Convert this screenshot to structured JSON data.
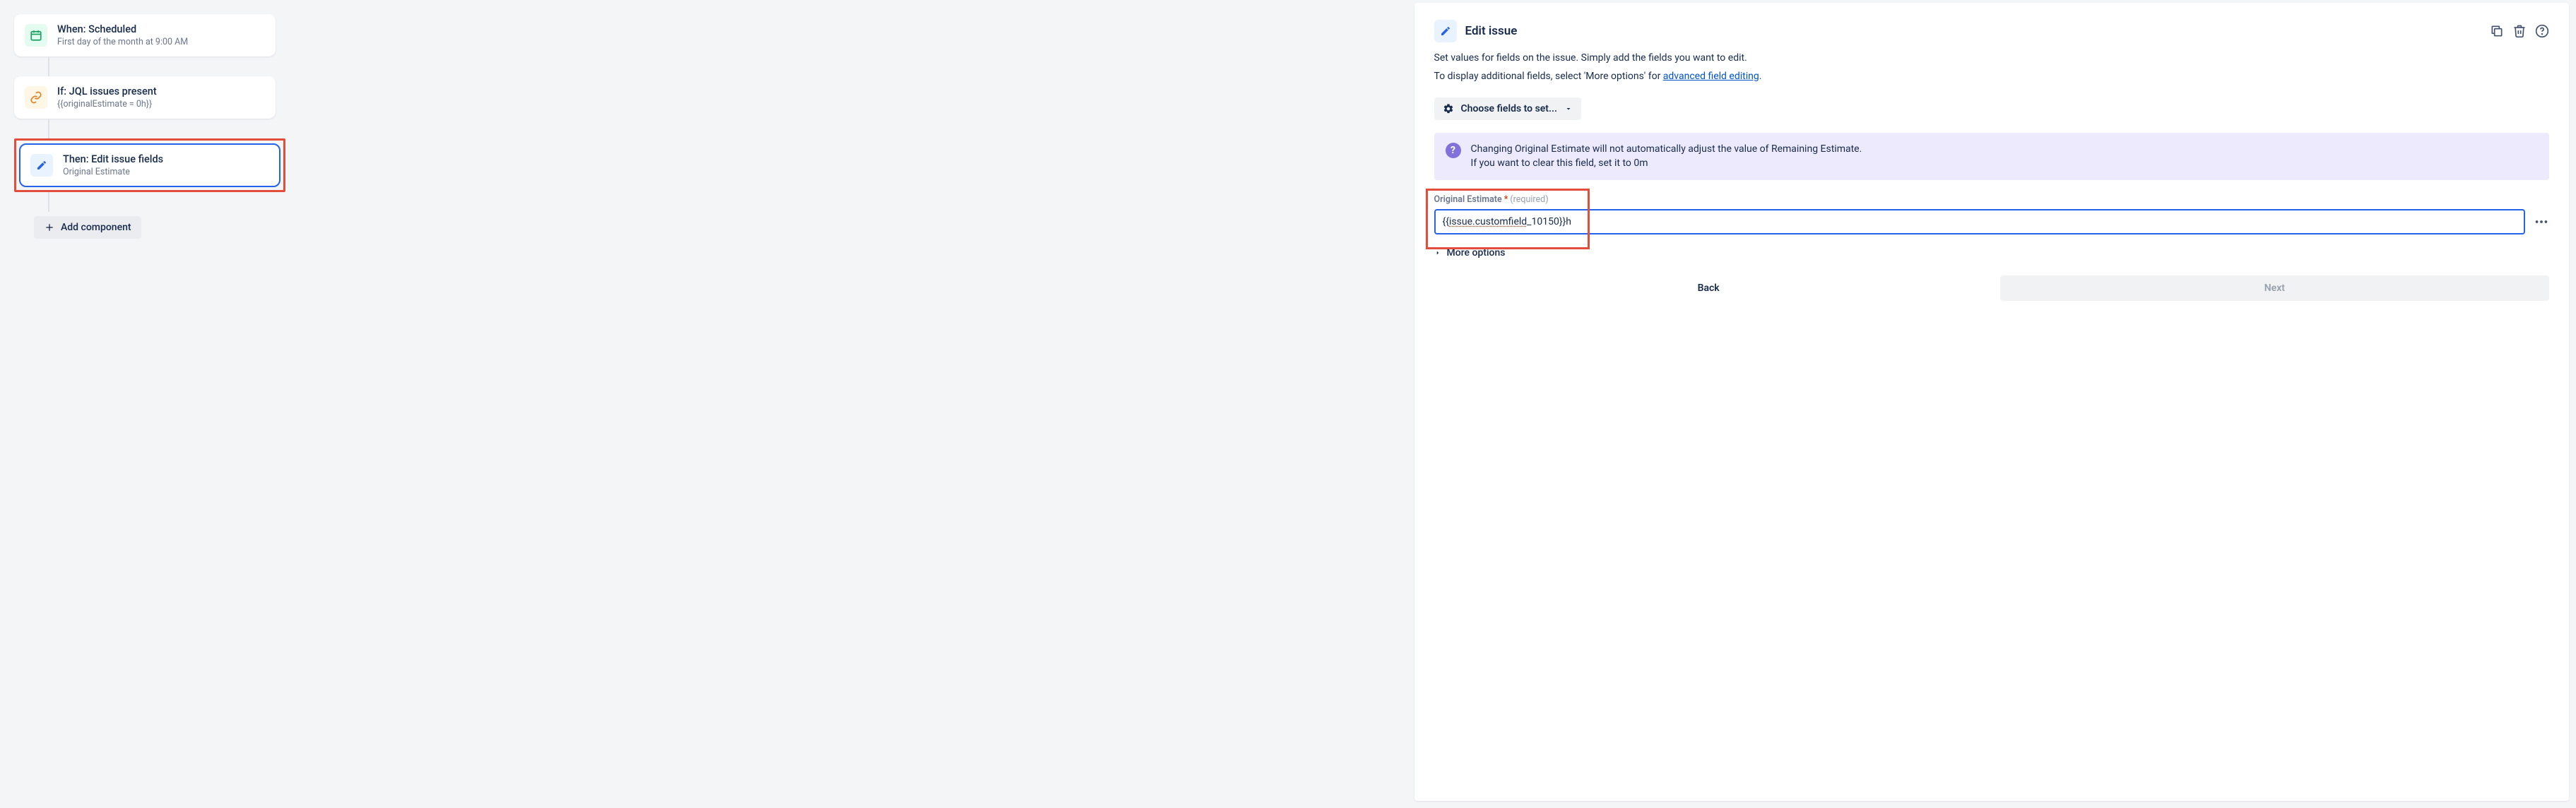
{
  "rules": {
    "trigger": {
      "title": "When: Scheduled",
      "sub": "First day of the month at 9:00 AM"
    },
    "condition": {
      "title": "If: JQL issues present",
      "sub": "{{originalEstimate = 0h}}"
    },
    "action": {
      "title": "Then: Edit issue fields",
      "sub": "Original Estimate"
    },
    "add_label": "Add component"
  },
  "panel": {
    "title": "Edit issue",
    "desc1": "Set values for fields on the issue. Simply add the fields you want to edit.",
    "desc2_prefix": "To display additional fields, select 'More options' for ",
    "desc2_link": "advanced field editing",
    "choose_fields": "Choose fields to set...",
    "info_line1": "Changing Original Estimate will not automatically adjust the value of Remaining Estimate.",
    "info_line2": "If you want to clear this field, set it to 0m",
    "field": {
      "label": "Original Estimate",
      "required": "*",
      "hint": "(required)",
      "value_prefix": "{{",
      "value_mid": "issue.customfield",
      "value_suffix": "_10150}}h"
    },
    "more_options": "More options",
    "back": "Back",
    "next": "Next"
  }
}
